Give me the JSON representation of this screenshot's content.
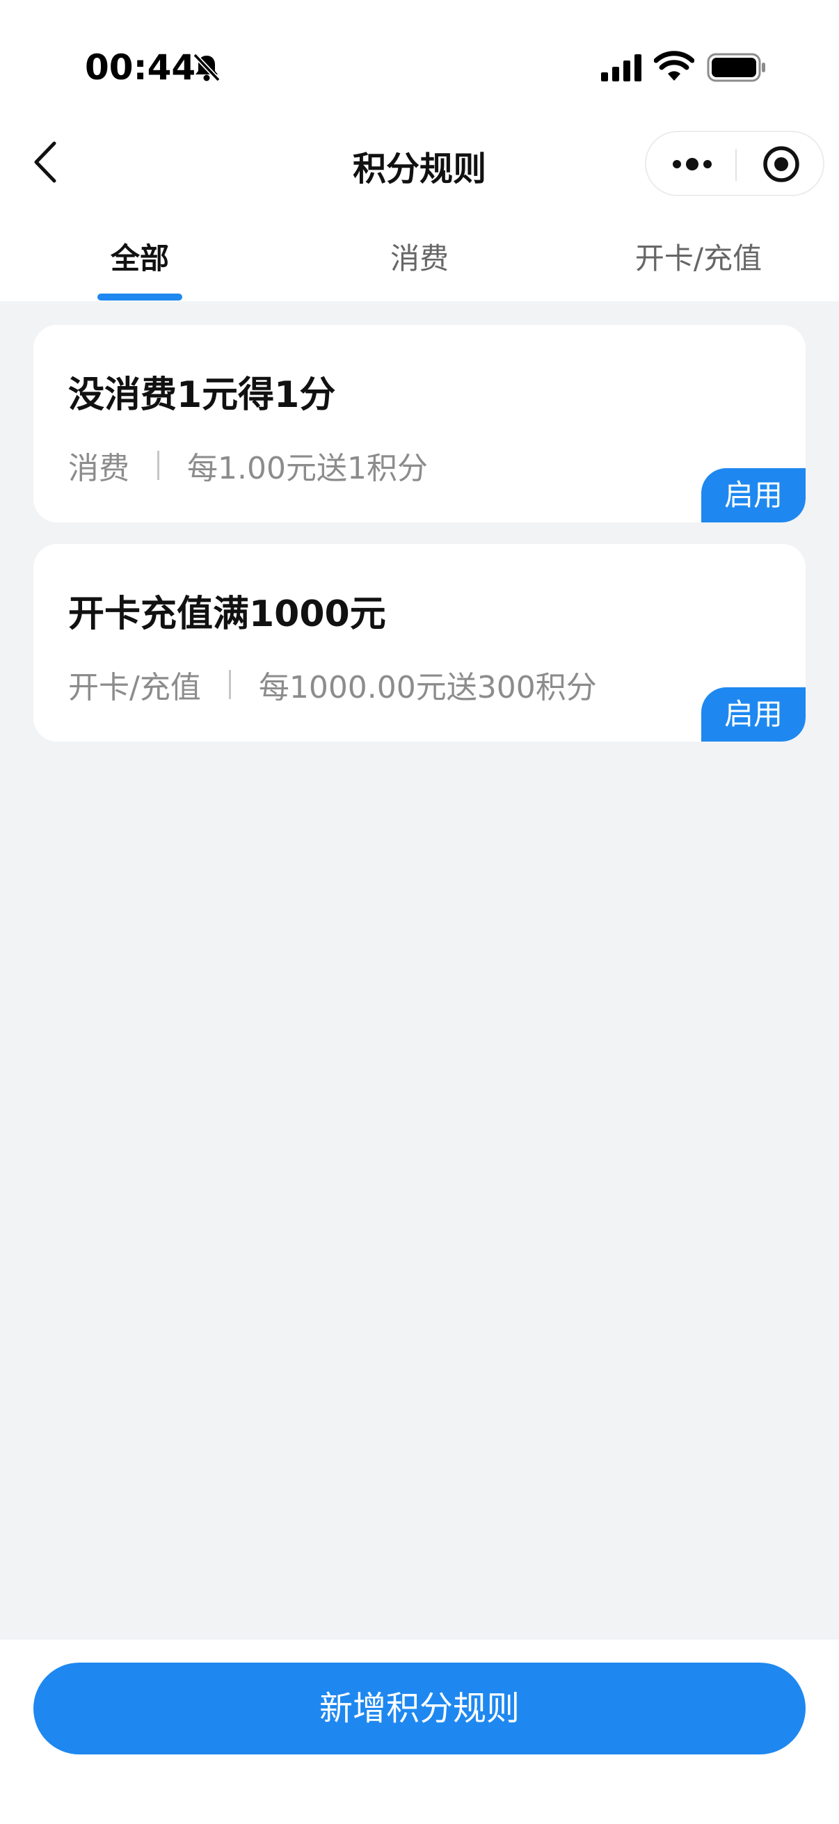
{
  "status_bar": {
    "time": "00:44",
    "icons": [
      "bell-off-icon",
      "signal-icon",
      "wifi-icon",
      "battery-icon"
    ]
  },
  "nav": {
    "title": "积分规则",
    "icons": [
      "back-icon",
      "more-icon",
      "target-icon"
    ]
  },
  "tabs": [
    {
      "label": "全部",
      "active": true
    },
    {
      "label": "消费",
      "active": false
    },
    {
      "label": "开卡/充值",
      "active": false
    }
  ],
  "rules": [
    {
      "title": "没消费1元得1分",
      "type": "消费",
      "desc": "每1.00元送1积分",
      "status": "启用"
    },
    {
      "title": "开卡充值满1000元",
      "type": "开卡/充值",
      "desc": "每1000.00元送300积分",
      "status": "启用"
    }
  ],
  "footer": {
    "add_label": "新增积分规则"
  },
  "colors": {
    "accent": "#1e88f0",
    "background": "#f2f3f5",
    "card": "#ffffff",
    "muted_text": "#8c8c8c"
  }
}
